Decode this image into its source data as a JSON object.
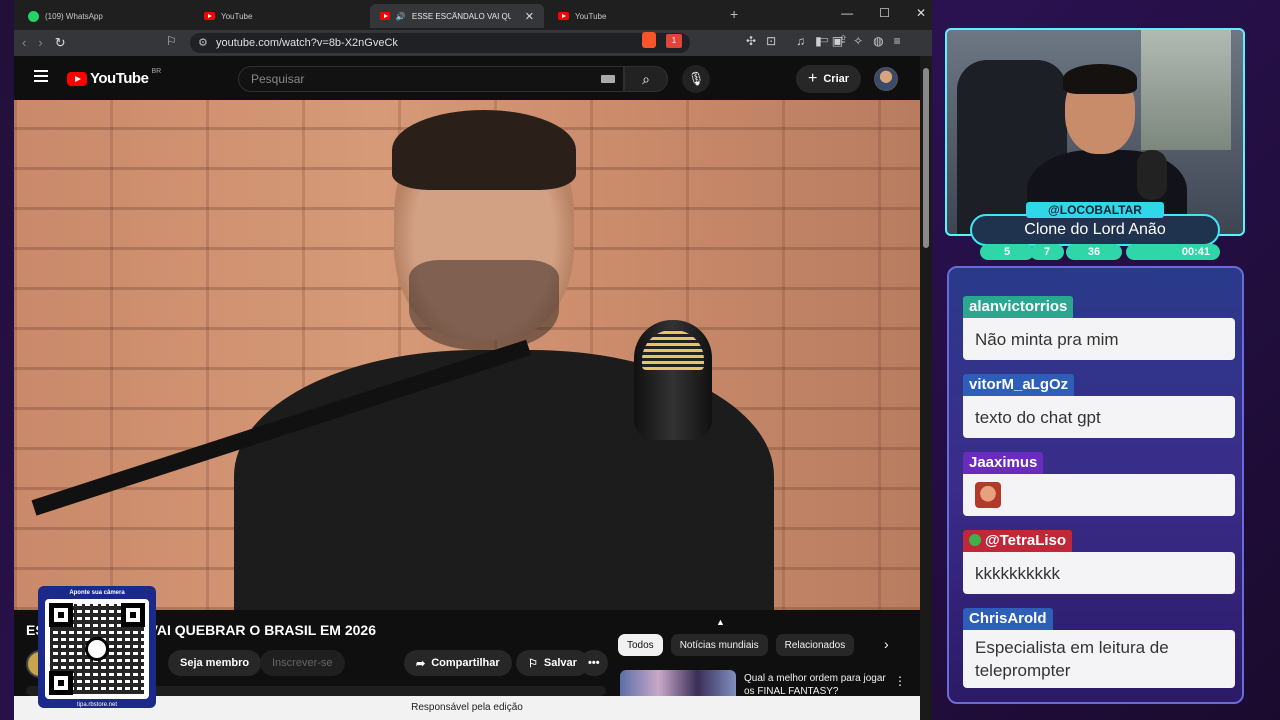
{
  "browser": {
    "tabs": [
      {
        "title": "(109) WhatsApp"
      },
      {
        "title": "YouTube"
      },
      {
        "title": "ESSE ESCÂNDALO VAI QUEBRAR O"
      },
      {
        "title": "YouTube"
      }
    ],
    "url": "youtube.com/watch?v=8b-X2nGveCk",
    "brave_badge": "1"
  },
  "youtube": {
    "logo": "YouTube",
    "country": "BR",
    "search_placeholder": "Pesquisar",
    "create_label": "Criar",
    "video_title_start": "ES",
    "video_title_end": "VAI QUEBRAR O BRASIL EM 2026",
    "join_label": "Seja membro",
    "subscribe_label": "Inscrever-se",
    "share_label": "Compartilhar",
    "save_label": "Salvar",
    "more_label": "•••",
    "chips": [
      "Todos",
      "Notícias mundiais",
      "Relacionados"
    ],
    "recommendation_title": "Qual a melhor ordem para jogar os FINAL FANTASY?",
    "footer": "Responsável pela edição"
  },
  "qr_overlay": {
    "top_text": "Aponte sua câmera",
    "bottom_text": "tipa.rbstore.net"
  },
  "streamer": {
    "handle": "@LOCOBALTAR",
    "title": "Clone do Lord Anão",
    "stats": [
      "5",
      "7",
      "36",
      "00:41"
    ]
  },
  "chat": [
    {
      "user": "alanvictorrios",
      "text": "Não minta pra mim",
      "color": "#2aa88f"
    },
    {
      "user": "vitorM_aLgOz",
      "text": "texto do chat gpt",
      "color": "#2d5fb8"
    },
    {
      "user": "Jaaximus",
      "text": "",
      "color": "#6a2bbf",
      "emote": "face-emote"
    },
    {
      "user": "@TetraLiso",
      "text": "kkkkkkkkkk",
      "color": "#c0283a"
    },
    {
      "user": "ChrisArold",
      "text": "Especialista em leitura de teleprompter",
      "color": "#2d5fb8"
    }
  ]
}
